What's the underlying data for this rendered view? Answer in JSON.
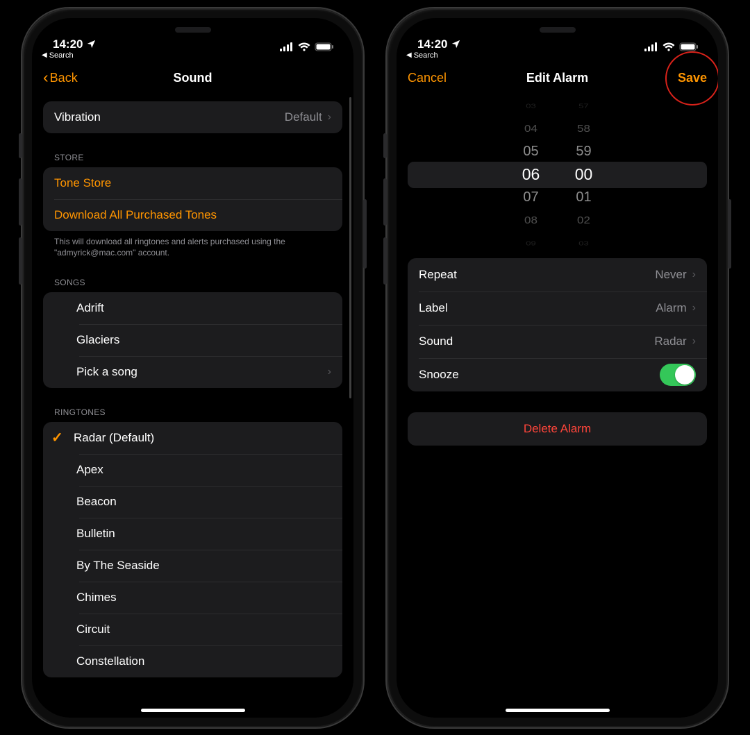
{
  "statusbar": {
    "time": "14:20",
    "breadcrumb_label": "Search"
  },
  "left": {
    "nav": {
      "back": "Back",
      "title": "Sound"
    },
    "vibration": {
      "label": "Vibration",
      "value": "Default"
    },
    "store": {
      "header": "STORE",
      "tone_store": "Tone Store",
      "download_all": "Download All Purchased Tones",
      "footer": "This will download all ringtones and alerts purchased using the \"admyrick@mac.com\" account."
    },
    "songs": {
      "header": "SONGS",
      "items": [
        "Adrift",
        "Glaciers"
      ],
      "pick": "Pick a song"
    },
    "ringtones": {
      "header": "RINGTONES",
      "items": [
        "Radar (Default)",
        "Apex",
        "Beacon",
        "Bulletin",
        "By The Seaside",
        "Chimes",
        "Circuit",
        "Constellation"
      ],
      "selected_index": 0
    }
  },
  "right": {
    "nav": {
      "cancel": "Cancel",
      "title": "Edit Alarm",
      "save": "Save"
    },
    "picker": {
      "hours": [
        "03",
        "04",
        "05",
        "06",
        "07",
        "08",
        "09"
      ],
      "minutes": [
        "57",
        "58",
        "59",
        "00",
        "01",
        "02",
        "03"
      ]
    },
    "options": {
      "repeat": {
        "label": "Repeat",
        "value": "Never"
      },
      "label": {
        "label": "Label",
        "value": "Alarm"
      },
      "sound": {
        "label": "Sound",
        "value": "Radar"
      },
      "snooze": {
        "label": "Snooze",
        "on": true
      }
    },
    "delete": "Delete Alarm"
  }
}
